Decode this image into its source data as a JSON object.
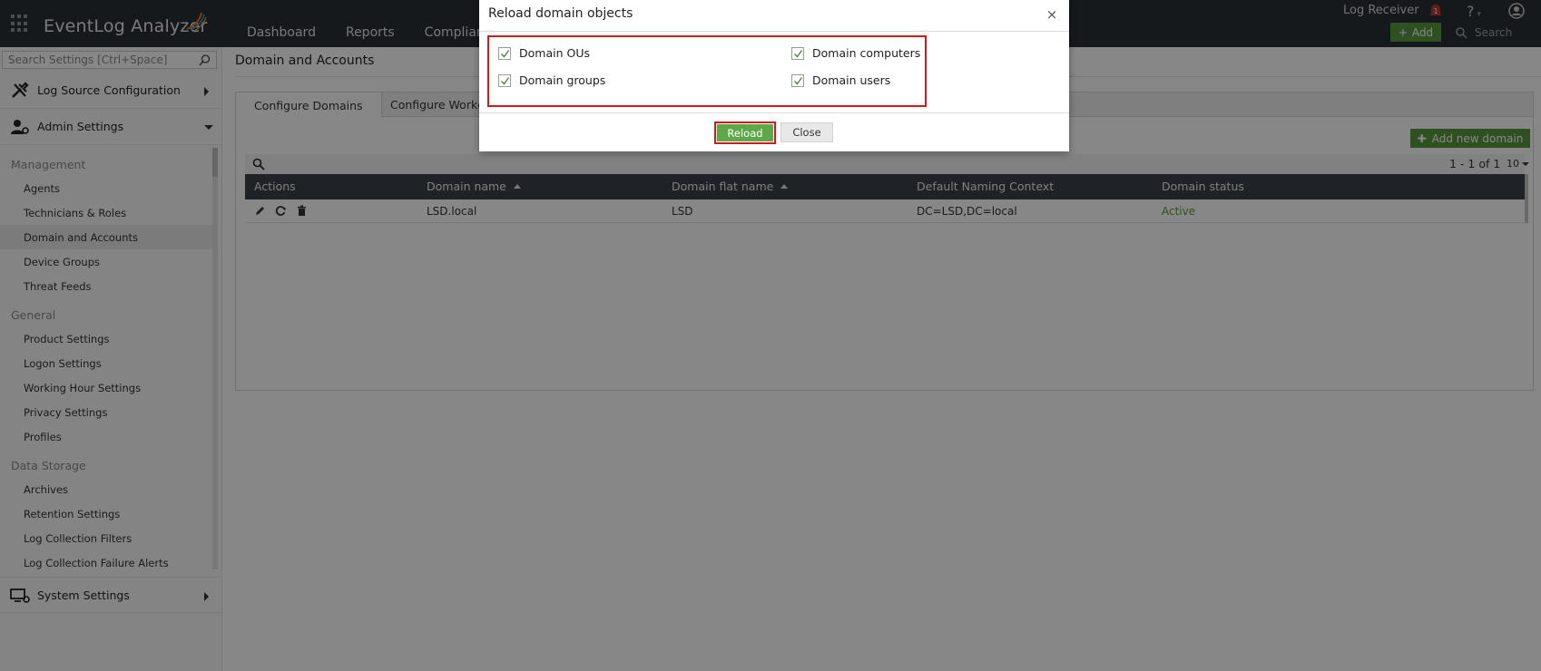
{
  "app": {
    "brand": "EventLog Analyzer",
    "nav": [
      "Dashboard",
      "Reports",
      "Compliance"
    ],
    "log_receiver": "Log Receiver",
    "add_label": "Add",
    "search_placeholder": "Search"
  },
  "sidebar": {
    "search_placeholder": "Search Settings [Ctrl+Space]",
    "sections": {
      "log_source": "Log Source Configuration",
      "admin": "Admin Settings",
      "system": "System Settings"
    },
    "groups": [
      {
        "title": "Management",
        "items": [
          "Agents",
          "Technicians & Roles",
          "Domain and Accounts",
          "Device Groups",
          "Threat Feeds"
        ]
      },
      {
        "title": "General",
        "items": [
          "Product Settings",
          "Logon Settings",
          "Working Hour Settings",
          "Privacy Settings",
          "Profiles"
        ]
      },
      {
        "title": "Data Storage",
        "items": [
          "Archives",
          "Retention Settings",
          "Log Collection Filters",
          "Log Collection Failure Alerts"
        ]
      }
    ],
    "active_item": "Domain and Accounts"
  },
  "main": {
    "page_title": "Domain and Accounts",
    "tabs": [
      "Configure Domains",
      "Configure Workgroups"
    ],
    "add_domain_label": "Add new domain",
    "pager": "1 - 1 of 1",
    "page_size": "10",
    "table": {
      "columns": [
        "Actions",
        "Domain name",
        "Domain flat name",
        "Default Naming Context",
        "Domain status"
      ],
      "rows": [
        {
          "domain_name": "LSD.local",
          "flat_name": "LSD",
          "naming_context": "DC=LSD,DC=local",
          "status": "Active"
        }
      ]
    }
  },
  "modal": {
    "title": "Reload domain objects",
    "close_symbol": "×",
    "options": [
      {
        "label": "Domain OUs",
        "checked": true
      },
      {
        "label": "Domain computers",
        "checked": true
      },
      {
        "label": "Domain groups",
        "checked": true
      },
      {
        "label": "Domain users",
        "checked": true
      }
    ],
    "reload_label": "Reload",
    "close_label": "Close"
  },
  "colors": {
    "topbar": "#2b3036",
    "accent_green": "#5a9a3f",
    "highlight_red": "#d01a1a",
    "table_header": "#3b4148"
  },
  "icons": {
    "notification_badge": "1",
    "help": "?"
  }
}
